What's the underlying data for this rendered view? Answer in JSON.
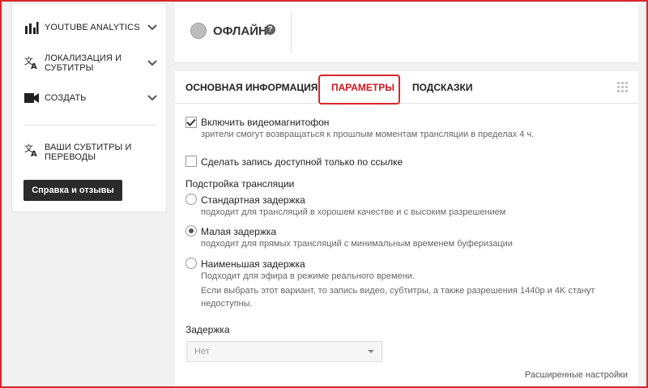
{
  "sidebar": {
    "items": [
      {
        "label": "YOUTUBE ANALYTICS",
        "icon": "bar-chart-icon"
      },
      {
        "label": "ЛОКАЛИЗАЦИЯ И",
        "label2": "СУБТИТРЫ",
        "icon": "translate-icon"
      },
      {
        "label": "СОЗДАТЬ",
        "icon": "video-camera-icon"
      },
      {
        "label": "ВАШИ СУБТИТРЫ И",
        "label2": "ПЕРЕВОДЫ",
        "icon": "translate-icon"
      }
    ],
    "help_button": "Справка и отзывы"
  },
  "status": {
    "text": "ОФЛАЙН",
    "help_glyph": "?"
  },
  "tabs": [
    {
      "label": "ОСНОВНАЯ ИНФОРМАЦИЯ",
      "active": false
    },
    {
      "label": "ПАРАМЕТРЫ",
      "active": true
    },
    {
      "label": "ПОДСКАЗКИ",
      "active": false
    }
  ],
  "settings": {
    "dvr": {
      "label": "Включить видеомагнитофон",
      "hint": "зрители смогут возвращаться к прошлым моментам трансляции в пределах 4 ч.",
      "checked": true
    },
    "unlisted": {
      "label": "Сделать запись доступной только по ссылке",
      "checked": false
    },
    "latency_title": "Подстройка трансляции",
    "latency_options": [
      {
        "label": "Стандартная задержка",
        "hint": "подходит для трансляций в хорошем качестве и с высоким разрешением",
        "checked": false
      },
      {
        "label": "Малая задержка",
        "hint": "подходит для прямых трансляций с минимальным временем буферизации",
        "checked": true
      },
      {
        "label": "Наименьшая задержка",
        "hint": "Подходит для эфира в режиме реального времени.",
        "checked": false
      }
    ],
    "lowest_note_1": "Если выбрать этот вариант, то запись видео, субтитры, а также разрешения 1440p и 4K станут",
    "lowest_note_2": "недоступны.",
    "delay_title": "Задержка",
    "delay_value": "Нет",
    "advanced_link": "Расширенные настройки"
  },
  "colors": {
    "accent": "#cc181e",
    "highlight_border": "#d9262b",
    "help_button_bg": "#2b2b2b"
  }
}
